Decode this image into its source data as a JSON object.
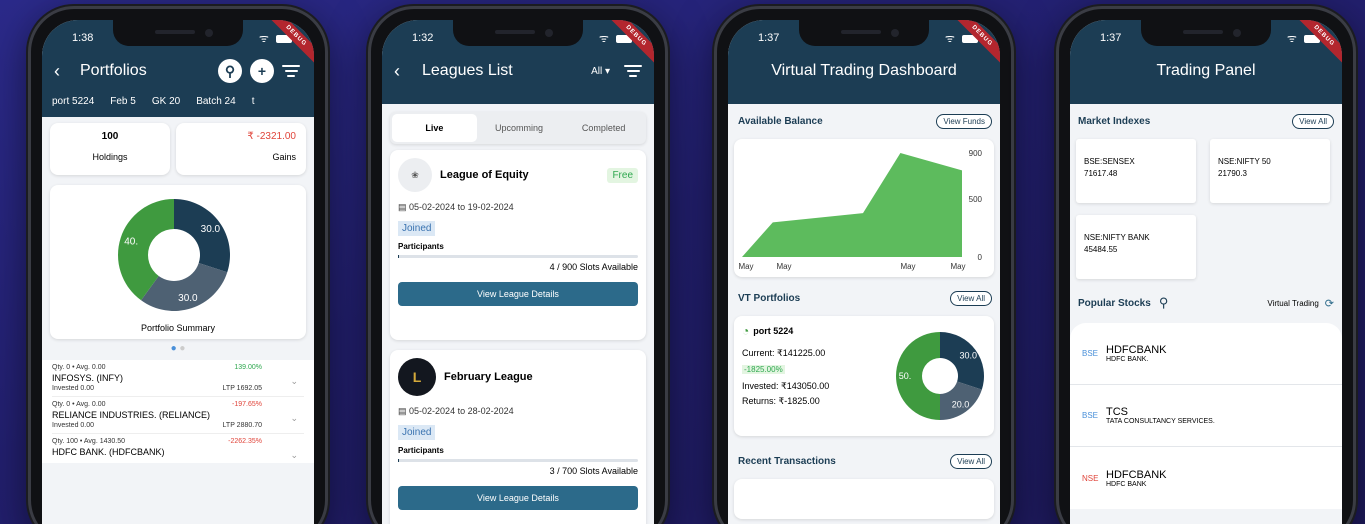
{
  "phone1": {
    "time": "1:38",
    "title": "Portfolios",
    "tabs": [
      "port 5224",
      "Feb 5",
      "GK 20",
      "Batch 24",
      "t"
    ],
    "holdings_value": "100",
    "holdings_label": "Holdings",
    "gains_value": "₹ -2321.00",
    "gains_label": "Gains",
    "donut": {
      "values": [
        30.0,
        30.0,
        40.0
      ],
      "labels": [
        "30.0",
        "30.0",
        "40."
      ],
      "colors": [
        "#1c3d54",
        "#4e6173",
        "#3f9a3f"
      ]
    },
    "summary_label": "Portfolio Summary",
    "stocks": [
      {
        "meta": "Qty. 0 • Avg. 0.00",
        "pct": "139.00%",
        "pct_color": "#2fa84f",
        "name": "INFOSYS. (INFY)",
        "invested": "Invested 0.00",
        "ltp": "LTP 1692.05"
      },
      {
        "meta": "Qty. 0 • Avg. 0.00",
        "pct": "-197.65%",
        "pct_color": "#e0443a",
        "name": "RELIANCE INDUSTRIES. (RELIANCE)",
        "invested": "Invested 0.00",
        "ltp": "LTP 2880.70"
      },
      {
        "meta": "Qty. 100 • Avg. 1430.50",
        "pct": "-2262.35%",
        "pct_color": "#e0443a",
        "name": "HDFC BANK. (HDFCBANK)",
        "invested": "",
        "ltp": ""
      }
    ]
  },
  "phone2": {
    "time": "1:32",
    "title": "Leagues List",
    "filter_label": "All ▾",
    "tabs": [
      "Live",
      "Upcomming",
      "Completed"
    ],
    "leagues": [
      {
        "name": "League of Equity",
        "badge": "Free",
        "dates": "05-02-2024 to 19-02-2024",
        "status": "Joined",
        "participants_label": "Participants",
        "slots": "4 / 900  Slots Available",
        "fill": 0.0044,
        "button": "View League Details"
      },
      {
        "name": "February League",
        "badge": "",
        "dates": "05-02-2024 to 28-02-2024",
        "status": "Joined",
        "participants_label": "Participants",
        "slots": "3 / 700  Slots Available",
        "fill": 0.0043,
        "button": "View League Details"
      }
    ]
  },
  "phone3": {
    "time": "1:37",
    "title": "Virtual Trading Dashboard",
    "balance_label": "Available Balance",
    "view_funds": "View Funds",
    "chart_data": {
      "type": "area",
      "x": [
        "May",
        "May",
        "",
        "May",
        "May"
      ],
      "y": [
        0,
        300,
        380,
        900,
        750
      ],
      "yticks": [
        "900",
        "500",
        "0"
      ],
      "ylim": [
        0,
        900
      ],
      "color": "#5dbb5d"
    },
    "vt_label": "VT Portfolios",
    "view_all": "View All",
    "portfolio": {
      "name": "port 5224",
      "current": "Current: ₹141225.00",
      "change": "-1825.00%",
      "invested": "Invested: ₹143050.00",
      "returns": "Returns: ₹-1825.00",
      "donut": {
        "values": [
          30.0,
          20.0,
          50.0
        ],
        "labels": [
          "30.0",
          "20.0",
          "50."
        ],
        "colors": [
          "#1c3d54",
          "#4e6173",
          "#3f9a3f"
        ]
      }
    },
    "recent_label": "Recent Transactions",
    "recent_view_all": "View All"
  },
  "phone4": {
    "time": "1:37",
    "title": "Trading Panel",
    "market_label": "Market Indexes",
    "view_all": "View All",
    "indexes": [
      {
        "name": "BSE:SENSEX",
        "value": "71617.48"
      },
      {
        "name": "NSE:NIFTY 50",
        "value": "21790.3"
      },
      {
        "name": "NSE:NIFTY BANK",
        "value": "45484.55"
      }
    ],
    "popular_label": "Popular Stocks",
    "virtual_label": "Virtual Trading",
    "stocks": [
      {
        "exchange": "BSE",
        "ex_color": "#4a90d9",
        "symbol": "HDFCBANK",
        "name": "HDFC BANK."
      },
      {
        "exchange": "BSE",
        "ex_color": "#4a90d9",
        "symbol": "TCS",
        "name": "TATA CONSULTANCY SERVICES."
      },
      {
        "exchange": "NSE",
        "ex_color": "#e0443a",
        "symbol": "HDFCBANK",
        "name": "HDFC BANK"
      }
    ]
  },
  "debug_label": "DEBUG"
}
